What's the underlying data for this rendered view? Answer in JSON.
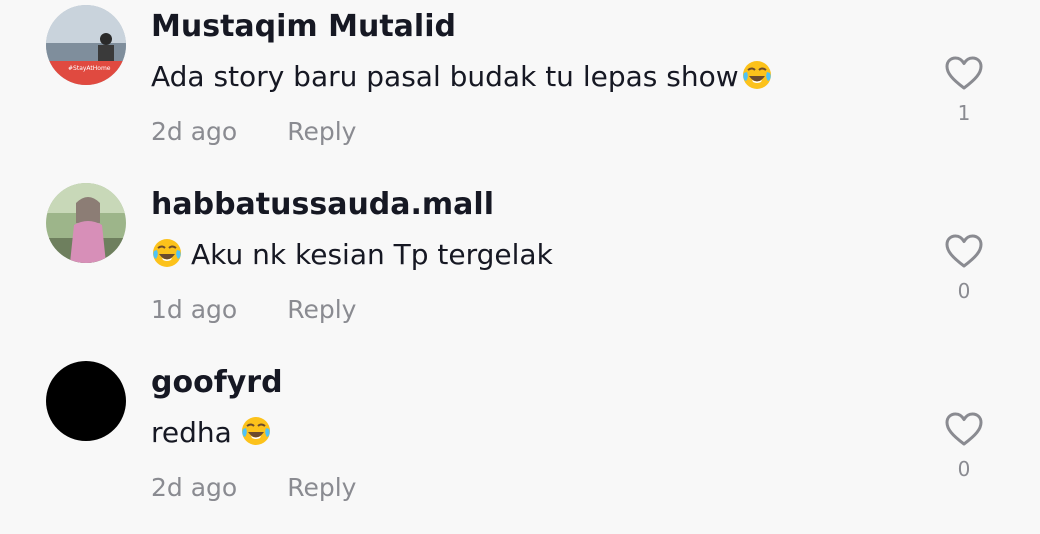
{
  "comments": [
    {
      "username": "Mustaqim Mutalid",
      "text": "Ada story baru pasal budak tu lepas show",
      "emoji": "face-with-tears-of-joy",
      "time": "2d ago",
      "reply_label": "Reply",
      "likes": "1",
      "avatar_text": "#StayAtHome"
    },
    {
      "username": "habbatussauda.mall",
      "text": "Aku nk kesian Tp tergelak",
      "emoji": "face-with-tears-of-joy",
      "time": "1d ago",
      "reply_label": "Reply",
      "likes": "0"
    },
    {
      "username": "goofyrd",
      "text": "redha",
      "emoji": "face-with-tears-of-joy",
      "time": "2d ago",
      "reply_label": "Reply",
      "likes": "0"
    }
  ],
  "colors": {
    "background": "#f8f8f8",
    "text": "#161823",
    "muted": "#8a8b91"
  }
}
